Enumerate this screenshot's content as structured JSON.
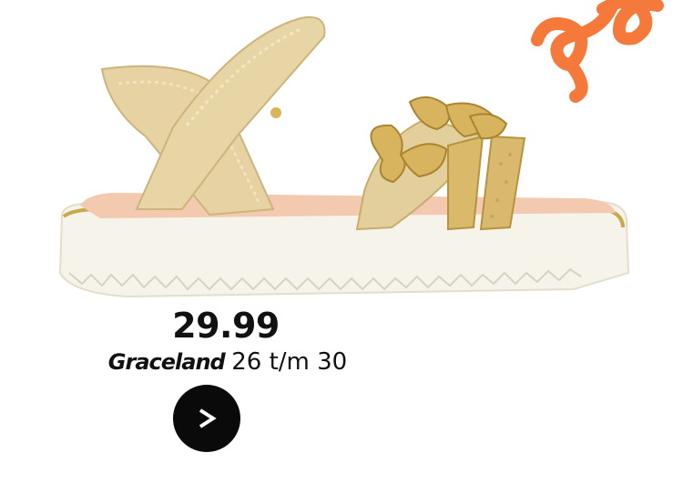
{
  "product": {
    "price": "29.99",
    "brand": "Graceland",
    "sizes": "26 t/m 30"
  },
  "icons": {
    "go_button": "chevron-right-icon",
    "decoration": "orange-swirl"
  },
  "colors": {
    "accent": "#f5793a",
    "button": "#0a0a0a"
  }
}
